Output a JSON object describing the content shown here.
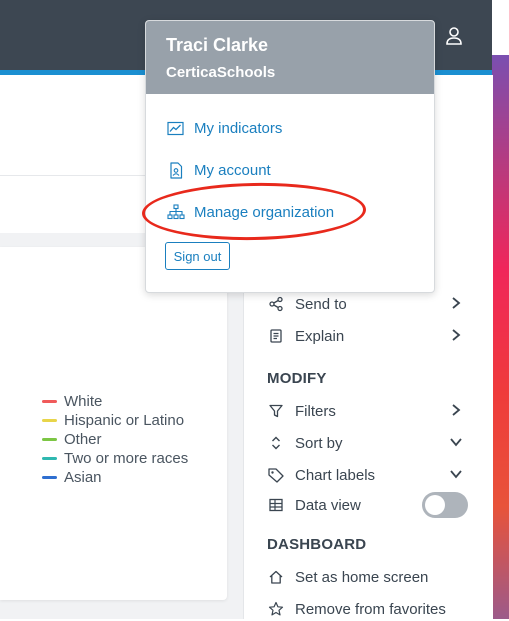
{
  "user_menu": {
    "name": "Traci Clarke",
    "organization": "CerticaSchools",
    "items": [
      {
        "label": "My indicators",
        "icon": "chart-line-icon"
      },
      {
        "label": "My account",
        "icon": "id-card-icon"
      },
      {
        "label": "Manage organization",
        "icon": "org-chart-icon"
      }
    ],
    "sign_out_label": "Sign out"
  },
  "legend": [
    {
      "label": "White",
      "color": "#f05a5a"
    },
    {
      "label": "Hispanic or Latino",
      "color": "#e8d54a"
    },
    {
      "label": "Other",
      "color": "#7cc644"
    },
    {
      "label": "Two or more races",
      "color": "#2fb8b0"
    },
    {
      "label": "Asian",
      "color": "#2f6fd0"
    }
  ],
  "actions_panel": {
    "send_to": "Send to",
    "explain": "Explain",
    "modify_heading": "MODIFY",
    "filters": "Filters",
    "sort_by": "Sort by",
    "chart_labels": "Chart labels",
    "data_view": "Data view",
    "data_view_enabled": false,
    "dashboard_heading": "DASHBOARD",
    "set_home": "Set as home screen",
    "remove_favorites": "Remove from favorites"
  },
  "colors": {
    "topbar": "#3d4752",
    "accent": "#1b8fd1",
    "link": "#1a7fbf",
    "annotation": "#e8291c"
  }
}
